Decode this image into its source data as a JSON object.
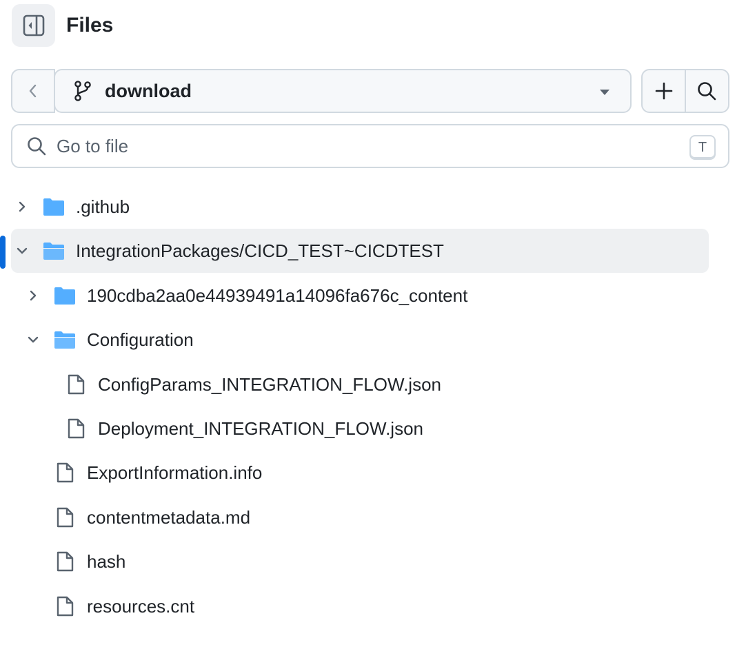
{
  "header": {
    "title": "Files",
    "toggle_icon": "sidebar-collapse-icon"
  },
  "branch": {
    "name": "download",
    "back_icon": "chevron-left-icon",
    "add_icon": "plus-icon",
    "search_icon": "search-icon"
  },
  "search": {
    "placeholder": "Go to file",
    "shortcut": "T"
  },
  "tree": [
    {
      "label": ".github",
      "type": "folder",
      "expanded": false,
      "depth": 0
    },
    {
      "label": "IntegrationPackages/CICD_TEST~CICDTEST",
      "type": "folder",
      "expanded": true,
      "depth": 0,
      "selected": true
    },
    {
      "label": "190cdba2aa0e44939491a14096fa676c_content",
      "type": "folder",
      "expanded": false,
      "depth": 1
    },
    {
      "label": "Configuration",
      "type": "folder",
      "expanded": true,
      "depth": 1
    },
    {
      "label": "ConfigParams_INTEGRATION_FLOW.json",
      "type": "file",
      "depth": 2
    },
    {
      "label": "Deployment_INTEGRATION_FLOW.json",
      "type": "file",
      "depth": 2
    },
    {
      "label": "ExportInformation.info",
      "type": "file",
      "depth": 1
    },
    {
      "label": "contentmetadata.md",
      "type": "file",
      "depth": 1
    },
    {
      "label": "hash",
      "type": "file",
      "depth": 1
    },
    {
      "label": "resources.cnt",
      "type": "file",
      "depth": 1
    }
  ],
  "colors": {
    "folder": "#54aeff",
    "accent": "#0969da",
    "muted": "#59636e"
  }
}
